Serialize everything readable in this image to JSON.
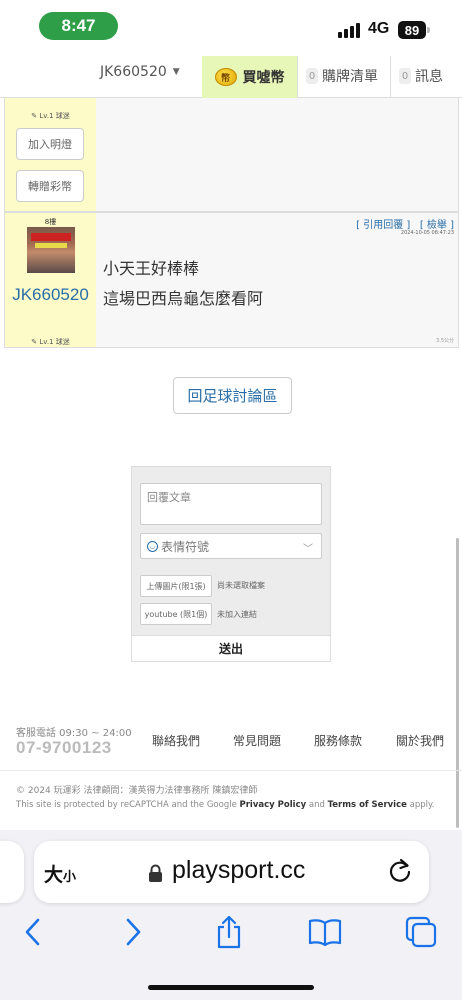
{
  "status_bar": {
    "time": "8:47",
    "network": "4G",
    "battery": "89"
  },
  "nav": {
    "username": "JK660520",
    "coin_label": "買噓幣",
    "coin_icon": "coin-icon",
    "list_count": "0",
    "list_label": "購牌清單",
    "msg_count": "0",
    "msg_label": "訊息"
  },
  "post_prev": {
    "level": "Lv.1 球迷",
    "btn_add_light": "加入明燈",
    "btn_gift": "轉贈彩幣"
  },
  "post": {
    "floor": "8樓",
    "author": "JK660520",
    "level": "Lv.1 球迷",
    "action_quote": "[ 引用回覆 ]",
    "action_report": "[ 檢舉 ]",
    "time": "2024-10-05 08:47:23",
    "lines": [
      "小天王好棒棒",
      "這場巴西烏龜怎麼看阿"
    ],
    "ip": "3.5公分"
  },
  "back_button": "回足球討論區",
  "reply": {
    "placeholder": "回覆文章",
    "emoji_label": "表情符號",
    "upload_image": "上傳圖片(限1張)",
    "upload_image_note": "尚未選取檔案",
    "youtube": "youtube (限1個)",
    "youtube_note": "未加入連結",
    "send": "送出"
  },
  "footer": {
    "service_label": "客服電話 09:30 ~ 24:00",
    "phone": "07-9700123",
    "links": [
      "聯絡我們",
      "常見問題",
      "服務條款",
      "關於我們"
    ],
    "copyright": "© 2024 玩運彩 法律顧問：漢英得力法律事務所 陳鎮宏律師",
    "captcha_prefix": "This site is protected by reCAPTCHA and the Google ",
    "privacy": "Privacy Policy",
    "and": " and ",
    "terms": "Terms of Service",
    "apply": " apply."
  },
  "browser": {
    "text_size_big": "大",
    "text_size_small": "小",
    "url": "playsport.cc"
  }
}
